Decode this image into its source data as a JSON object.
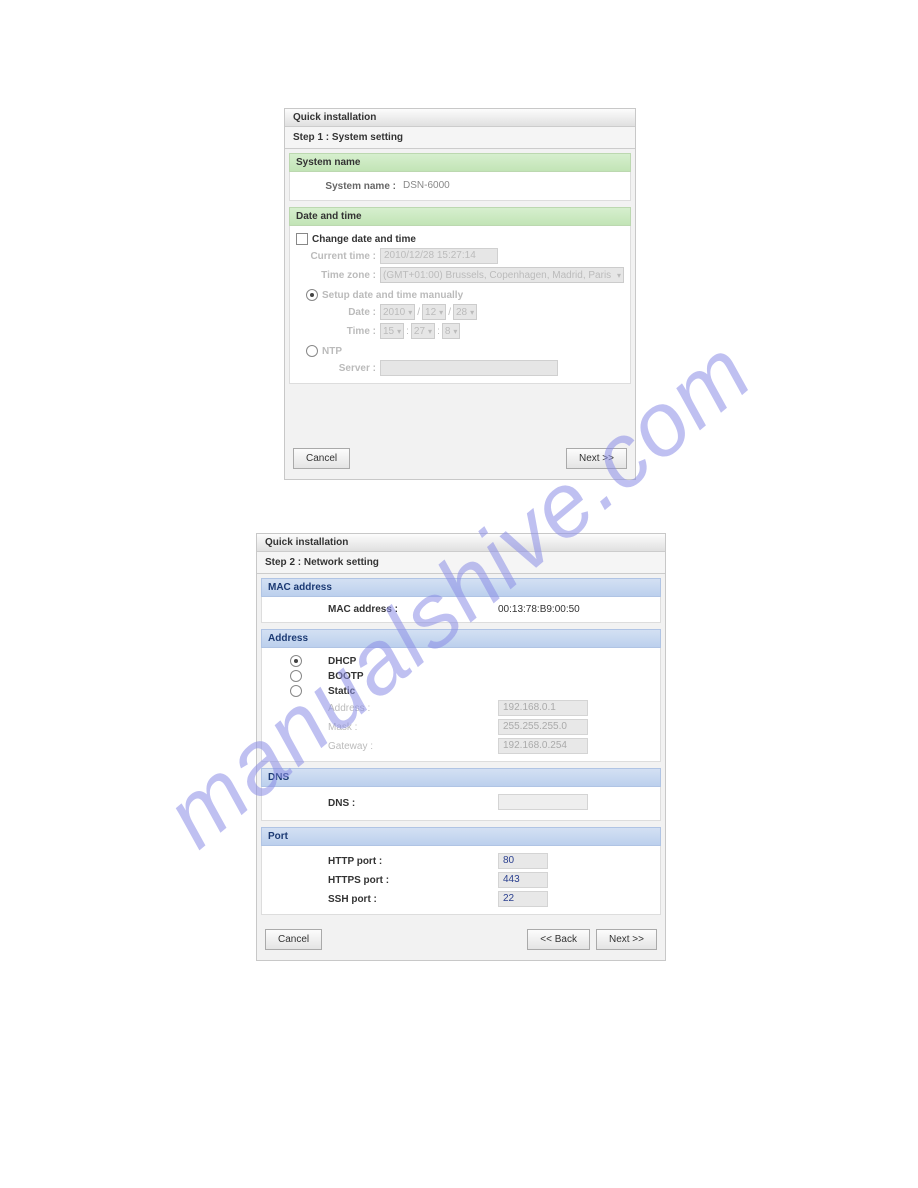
{
  "watermark": "manualshive.com",
  "panel1": {
    "title": "Quick installation",
    "step": "Step 1 : System setting",
    "system_name_section": "System name",
    "system_name_label": "System name :",
    "system_name_value": "DSN-6000",
    "datetime_section": "Date and time",
    "change_dt_label": "Change date and time",
    "current_time_label": "Current time :",
    "current_time_value": "2010/12/28 15:27:14",
    "timezone_label": "Time zone :",
    "timezone_value": "(GMT+01:00) Brussels, Copenhagen, Madrid, Paris",
    "manual_label": "Setup date and time manually",
    "date_label": "Date :",
    "date_y": "2010",
    "date_m": "12",
    "date_d": "28",
    "time_label": "Time :",
    "time_h": "15",
    "time_min": "27",
    "time_s": "8",
    "ntp_label": "NTP",
    "server_label": "Server :",
    "cancel": "Cancel",
    "next": "Next >>"
  },
  "panel2": {
    "title": "Quick installation",
    "step": "Step 2 : Network setting",
    "mac_section": "MAC address",
    "mac_label": "MAC address :",
    "mac_value": "00:13:78:B9:00:50",
    "addr_section": "Address",
    "opt_dhcp": "DHCP",
    "opt_bootp": "BOOTP",
    "opt_static": "Static",
    "address_label": "Address :",
    "address_value": "192.168.0.1",
    "mask_label": "Mask :",
    "mask_value": "255.255.255.0",
    "gateway_label": "Gateway :",
    "gateway_value": "192.168.0.254",
    "dns_section": "DNS",
    "dns_label": "DNS :",
    "port_section": "Port",
    "http_label": "HTTP port :",
    "http_value": "80",
    "https_label": "HTTPS port :",
    "https_value": "443",
    "ssh_label": "SSH port :",
    "ssh_value": "22",
    "cancel": "Cancel",
    "back": "<< Back",
    "next": "Next >>"
  }
}
